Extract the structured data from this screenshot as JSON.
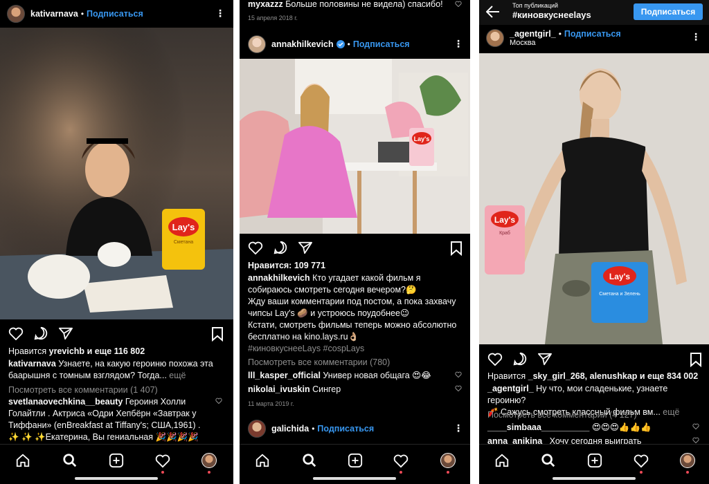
{
  "screens": {
    "p1": {
      "header": {
        "username": "kativarnava",
        "follow": "Подписаться"
      },
      "likes": {
        "prefix": "Нравится",
        "names": "yrevichb",
        "and": "и еще",
        "count": "116 802"
      },
      "caption": {
        "author": "kativarnava",
        "line1": "Узнаете, на какую героиню похожа эта",
        "line2": "баарышня с томным взглядом? Тогда...",
        "more": "ещё"
      },
      "view_comments": "Посмотреть все комментарии (1 407)",
      "comment": {
        "author": "svetlanaovechkina__beauty",
        "line1": "Героиня Холли",
        "line2": "Голайтли . Актриса «Одри Хепбёрн «Завтрак у",
        "line3": "Тиффани» (enBreakfast at Tiffany's; США,1961) .",
        "line4": "✨ ✨ ✨Екатерина, Вы гениальная 🎉🎉🎉🎉"
      },
      "photo_label": "Lay's",
      "photo_flavor": "Сметана"
    },
    "p2": {
      "top_comment": {
        "author": "myxazzz",
        "text": "Больше половины не видела) спасибо!"
      },
      "top_date": "15 апреля 2018 г.",
      "header": {
        "username": "annakhilkevich",
        "follow": "Подписаться"
      },
      "likes": {
        "prefix": "Нравится:",
        "count": "109 771"
      },
      "caption": {
        "author": "annakhilkevich",
        "line1": "Кто угадает какой фильм я",
        "line2": "собираюсь смотреть сегодня вечером?🤔",
        "line3": "Жду ваши комментарии под постом, а пока захвачу",
        "line4": "чипсы Lay's 🥔 и устроюсь поудобнее😉",
        "line5": "Кстати, смотреть фильмы теперь можно абсолютно",
        "line6": "бесплатно на kino.lays.ru👌🏼",
        "line7": "#киновкуснееLays #cospLays"
      },
      "view_comments": "Посмотреть все комментарии (780)",
      "comments": [
        {
          "author": "lll_kasper_official",
          "text": "Универ новая общага 😍😂"
        },
        {
          "author": "nikolai_ivuskin",
          "text": "Сингер"
        }
      ],
      "date": "11 марта 2019 г.",
      "next_post": {
        "username": "galichida",
        "follow": "Подписаться"
      },
      "photo_label": "Lay's"
    },
    "p3": {
      "topbar": {
        "small": "Топ публикаций",
        "title": "#киновкуснееlays",
        "follow_button": "Подписаться"
      },
      "header": {
        "username": "_agentgirl_",
        "follow": "Подписаться",
        "location": "Москва"
      },
      "likes": {
        "prefix": "Нравится",
        "names": "_sky_girl_268, alenushkap",
        "and": "и еще",
        "count": "834 002"
      },
      "caption": {
        "author": "_agentgirl_",
        "line1": "Ну что, мои сладенькие, узнаете героиню?",
        "line2": "🧨 Сажусь смотреть классный фильм вм...",
        "more": "ещё"
      },
      "view_comments": "Посмотреть все комментарии (4 127)",
      "comments": [
        {
          "author": "____simbaaa__________",
          "text": "😍😍😍👍👍👍"
        },
        {
          "author": "anna_anikina_",
          "text": "Хочу сегодня выиграть"
        }
      ],
      "photo_label_1": "Lay's",
      "photo_flavor_1": "Краб",
      "photo_label_2": "Lay's",
      "photo_flavor_2": "Сметана и Зелень"
    }
  },
  "icons": [
    "heart-icon",
    "comment-icon",
    "share-icon",
    "bookmark-icon",
    "home-icon",
    "search-icon",
    "add-icon",
    "activity-icon",
    "profile-icon",
    "back-arrow-icon",
    "more-icon",
    "verified-icon"
  ],
  "colors": {
    "background": "#000000",
    "link": "#3897f0",
    "muted": "#8e8e8e",
    "text": "#fafafa",
    "notification": "#ed4956"
  }
}
